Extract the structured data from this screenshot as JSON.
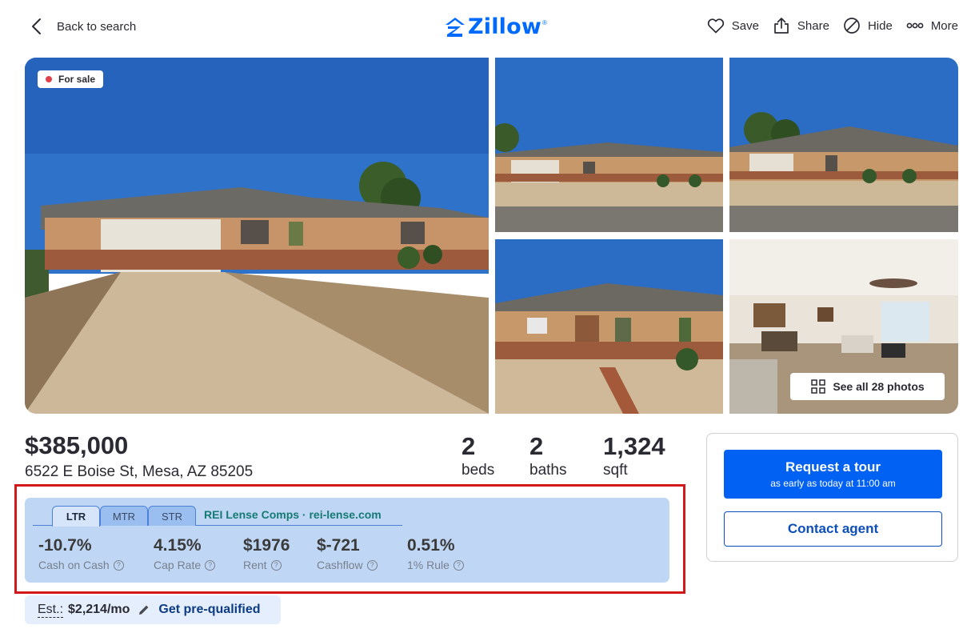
{
  "header": {
    "back_label": "Back to search",
    "logo_text": "Zillow",
    "logo_mark": "®",
    "actions": {
      "save": "Save",
      "share": "Share",
      "hide": "Hide",
      "more": "More"
    }
  },
  "gallery": {
    "status_badge": "For sale",
    "see_all": "See all 28 photos"
  },
  "listing": {
    "price": "$385,000",
    "address": "6522 E Boise St, Mesa, AZ 85205",
    "beds": {
      "value": "2",
      "unit": "beds"
    },
    "baths": {
      "value": "2",
      "unit": "baths"
    },
    "sqft": {
      "value": "1,324",
      "unit": "sqft"
    }
  },
  "rei": {
    "tabs": [
      "LTR",
      "MTR",
      "STR"
    ],
    "active_tab": "LTR",
    "comps_link": "REI Lense Comps · rei-lense.com",
    "metrics": [
      {
        "value": "-10.7%",
        "label": "Cash on Cash"
      },
      {
        "value": "4.15%",
        "label": "Cap Rate"
      },
      {
        "value": "$1976",
        "label": "Rent"
      },
      {
        "value": "$-721",
        "label": "Cashflow"
      },
      {
        "value": "0.51%",
        "label": "1% Rule"
      }
    ],
    "help_glyph": "?"
  },
  "estimate": {
    "label": "Est.:",
    "amount": "$2,214/mo",
    "link": "Get pre-qualified"
  },
  "contact_card": {
    "tour_title": "Request a tour",
    "tour_subtitle": "as early as today at 11:00 am",
    "contact": "Contact agent"
  },
  "colors": {
    "brand": "#006aff",
    "primary_button": "#0061f2",
    "panel_bg": "#bfd6f5",
    "highlight_border": "#d3181c",
    "teal_link": "#157a74",
    "status_dot": "#e1424a"
  }
}
